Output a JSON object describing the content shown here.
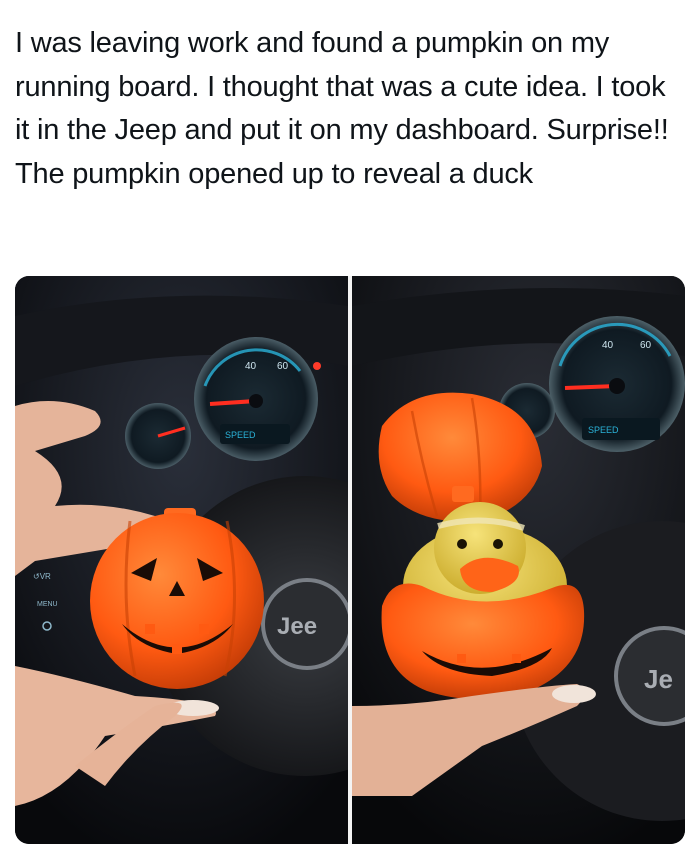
{
  "post": {
    "text": "I was leaving work and found a pumpkin on my running board. I thought that was a cute idea. I took it in the Jeep and put it on my dashboard. Surprise!! The pumpkin opened up to reveal a duck"
  },
  "photos": {
    "left": {
      "steering_badge": "Jee",
      "cluster_label": "SPEED",
      "menu_label": "MENU"
    },
    "right": {
      "steering_badge": "Je",
      "cluster_label": "SPEED"
    }
  },
  "colors": {
    "pumpkin": "#ff5a12",
    "duck": "#e8cf3a",
    "cluster_glow": "#2bb3d9",
    "needle": "#ff2e20",
    "background": "#0c0d11"
  }
}
